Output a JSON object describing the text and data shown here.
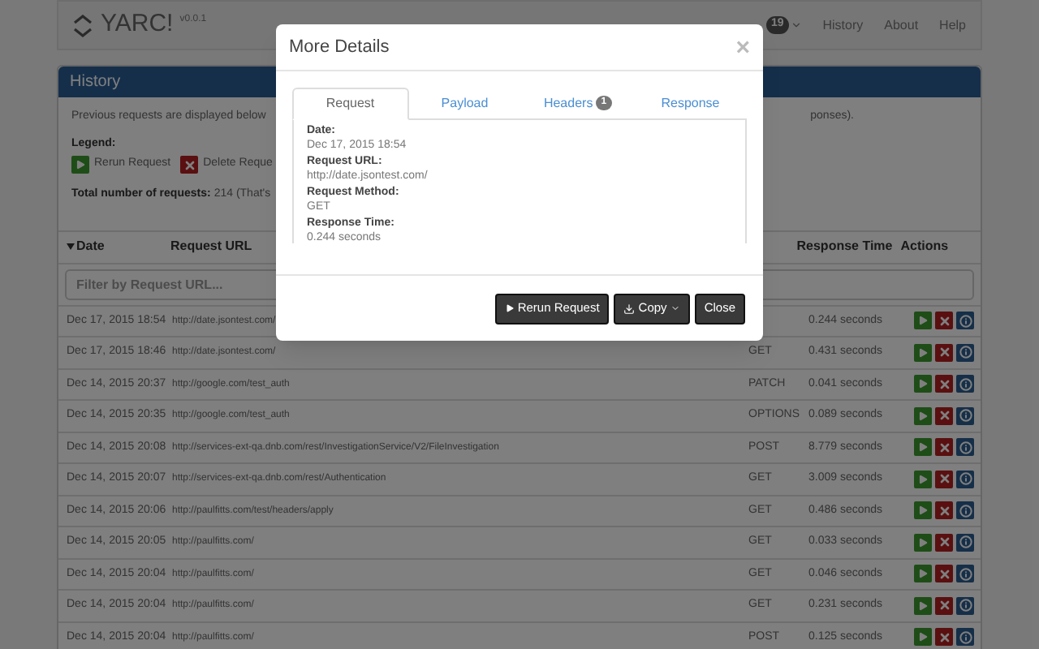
{
  "brand": {
    "name": "YARC!",
    "version": "v0.0.1"
  },
  "nav": [
    {
      "label": "19",
      "kind": "badge"
    },
    {
      "label": "History",
      "kind": "link"
    },
    {
      "label": "About",
      "kind": "link"
    },
    {
      "label": "Help",
      "kind": "link"
    }
  ],
  "panel": {
    "title": "History",
    "intro": "Previous requests are displayed below",
    "intro_end": "ponses).",
    "legend_label": "Legend:",
    "legend": [
      {
        "kind": "rerun",
        "label": "Rerun Request"
      },
      {
        "kind": "delete",
        "label": "Delete Reque"
      }
    ],
    "total_label": "Total number of requests:",
    "total_value": "214 (That's"
  },
  "table": {
    "columns": [
      {
        "label": "Date",
        "sorted": true
      },
      {
        "label": "Request URL",
        "sorted": false
      },
      {
        "label": "Response Time",
        "sorted": false
      },
      {
        "label": "Actions",
        "sorted": false
      }
    ],
    "filter": {
      "placeholder": "Filter by Request URL..."
    },
    "rows": [
      {
        "date": "Dec 17, 2015 18:54",
        "url": "http://date.jsontest.com/",
        "time": "0.244 seconds"
      },
      {
        "date": "Dec 17, 2015 18:46",
        "url": "http://date.jsontest.com/",
        "method": "GET",
        "time": "0.431 seconds"
      },
      {
        "date": "Dec 14, 2015 20:37",
        "url": "http://google.com/test_auth",
        "method": "PATCH",
        "time": "0.041 seconds"
      },
      {
        "date": "Dec 14, 2015 20:35",
        "url": "http://google.com/test_auth",
        "method": "OPTIONS",
        "time": "0.089 seconds"
      },
      {
        "date": "Dec 14, 2015 20:08",
        "url": "http://services-ext-qa.dnb.com/rest/InvestigationService/V2/FileInvestigation",
        "method": "POST",
        "time": "8.779 seconds"
      },
      {
        "date": "Dec 14, 2015 20:07",
        "url": "http://services-ext-qa.dnb.com/rest/Authentication",
        "method": "GET",
        "time": "3.009 seconds"
      },
      {
        "date": "Dec 14, 2015 20:06",
        "url": "http://paulfitts.com/test/headers/apply",
        "method": "GET",
        "time": "0.486 seconds"
      },
      {
        "date": "Dec 14, 2015 20:05",
        "url": "http://paulfitts.com/",
        "method": "GET",
        "time": "0.033 seconds"
      },
      {
        "date": "Dec 14, 2015 20:04",
        "url": "http://paulfitts.com/",
        "method": "GET",
        "time": "0.046 seconds"
      },
      {
        "date": "Dec 14, 2015 20:04",
        "url": "http://paulfitts.com/",
        "method": "GET",
        "time": "0.231 seconds"
      },
      {
        "date": "Dec 14, 2015 20:04",
        "url": "http://paulfitts.com/",
        "method": "POST",
        "time": "0.125 seconds"
      }
    ]
  },
  "modal": {
    "title": "More Details",
    "close": "×",
    "tabs": [
      {
        "label": "Request",
        "selected": true
      },
      {
        "label": "Payload",
        "selected": false
      },
      {
        "label": "Headers",
        "selected": false,
        "badge": "1"
      },
      {
        "label": "Response",
        "selected": false
      }
    ],
    "fields": [
      {
        "label": "Date:",
        "value": "Dec 17, 2015 18:54"
      },
      {
        "label": "Request URL:",
        "value": "http://date.jsontest.com/"
      },
      {
        "label": "Request Method:",
        "value": "GET"
      },
      {
        "label": "Response Time:",
        "value": "0.244 seconds"
      }
    ],
    "buttons": [
      {
        "kind": "rerun",
        "label": "Rerun Request"
      },
      {
        "kind": "copy",
        "label": "Copy"
      },
      {
        "kind": "close",
        "label": "Close"
      }
    ]
  }
}
